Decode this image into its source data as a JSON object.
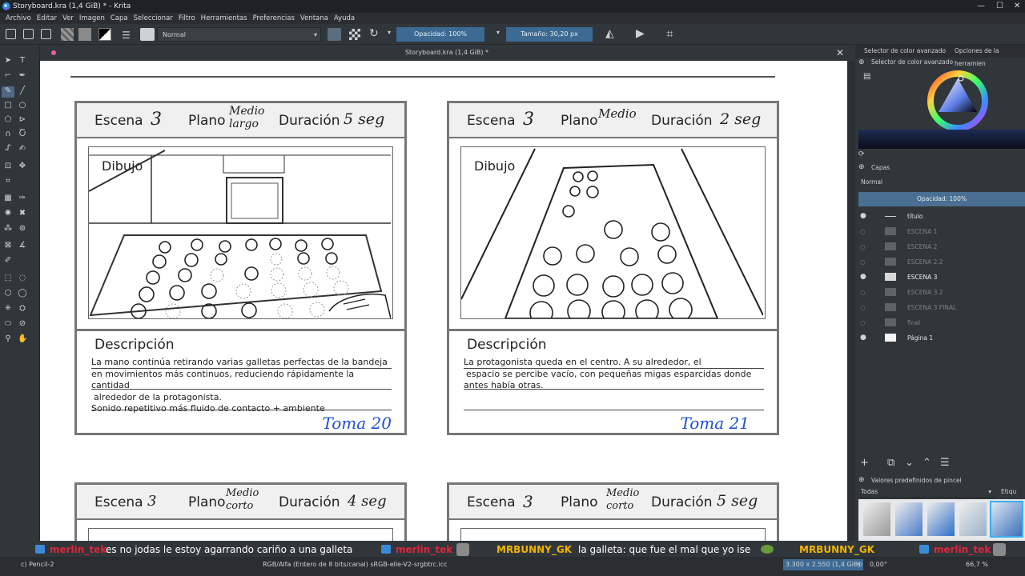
{
  "window": {
    "title": "Storyboard.kra (1,4 GiB) * - Krita"
  },
  "menu": [
    "Archivo",
    "Editar",
    "Ver",
    "Imagen",
    "Capa",
    "Seleccionar",
    "Filtro",
    "Herramientas",
    "Preferencias",
    "Ventana",
    "Ayuda"
  ],
  "toolbar": {
    "blend_mode": "Normal",
    "opacity": "Opacidad: 100%",
    "size": "Tamaño: 30,20 px"
  },
  "document": {
    "tab_title": "Storyboard.kra (1,4 GiB) *"
  },
  "storyboard": {
    "panels": [
      {
        "escena_label": "Escena",
        "escena": "3",
        "plano_label": "Plano",
        "plano": "Medio largo",
        "duracion_label": "Duración",
        "duracion": "5 seg",
        "dibujo": "Dibujo",
        "descripcion_label": "Descripción",
        "desc_lines": [
          "La mano continúa retirando varias galletas perfectas de la bandeja",
          "en movimientos más continuos, reduciendo rápidamente la cantidad",
          "alrededor de la protagonista.",
          "Sonido repetitivo más fluido de contacto + ambiente"
        ],
        "toma": "Toma 20"
      },
      {
        "escena_label": "Escena",
        "escena": "3",
        "plano_label": "Plano",
        "plano": "Medio",
        "duracion_label": "Duración",
        "duracion": "2 seg",
        "dibujo": "Dibujo",
        "descripcion_label": "Descripción",
        "desc_lines": [
          "La protagonista queda en el centro. A su alrededor, el",
          "espacio se percibe vacío, con pequeñas migas esparcidas donde",
          "antes había otras."
        ],
        "toma": "Toma 21"
      },
      {
        "escena_label": "Escena",
        "escena": "3",
        "plano_label": "Plano",
        "plano": "Medio corto",
        "duracion_label": "Duración",
        "duracion": "4 seg"
      },
      {
        "escena_label": "Escena",
        "escena": "3",
        "plano_label": "Plano",
        "plano": "Medio corto",
        "duracion_label": "Duración",
        "duracion": "5 seg"
      }
    ]
  },
  "dockers": {
    "tab1": "Selector de color avanzado",
    "tab2": "Opciones de la herramien",
    "color_selector_title": "Selector de color avanzado",
    "layers_title": "Capas",
    "layer_blend": "Normal",
    "layer_opacity": "Opacidad:  100%",
    "layers": [
      "título",
      "ESCENA 1",
      "ESCENA 2",
      "ESCENA 2.2",
      "ESCENA 3",
      "ESCENA 3.2",
      "ESCENA 3 FINAL",
      "final",
      "Página 1"
    ],
    "brush_presets_title": "Valores predefinidos de pincel",
    "brush_filter": "Todas",
    "brush_tag": "Etiqu"
  },
  "chat": [
    {
      "user": "merlin_tek",
      "color": "#e0243a",
      "msg": "es no jodas le estoy agarrando cariño a una galleta"
    },
    {
      "user": "merlin_tek",
      "color": "#e0243a",
      "msg": ""
    },
    {
      "user": "MRBUNNY_GK",
      "color": "#f0b400",
      "msg": "la galleta: que fue el mal que yo ise"
    },
    {
      "user": "MRBUNNY_GK",
      "color": "#f0b400",
      "msg": ""
    },
    {
      "user": "merlin_tek",
      "color": "#e0243a",
      "msg": ""
    }
  ],
  "status": {
    "brush": "c) Pencil-2",
    "color_space": "RGB/Alfa (Entero de 8 bits/canal)  sRGB-elle-V2-srgbtrc.icc",
    "dims": "3.300 x 2.550 (1,4 GiB)",
    "rotation": "0,00°",
    "zoom": "66,7 %"
  },
  "colors": {
    "accent": "#3daee9",
    "highlight_blue": "#1f4fd6",
    "bg": "#31363b"
  }
}
